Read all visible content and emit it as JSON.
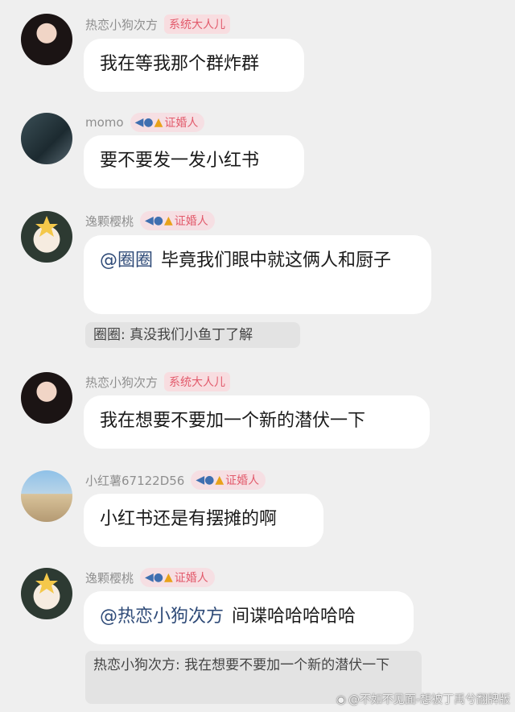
{
  "messages": [
    {
      "username": "热恋小狗次方",
      "badge": "系统大人儿",
      "text": "我在等我那个群炸群"
    },
    {
      "username": "momo",
      "badge": "证婚人",
      "text": "要不要发一发小红书"
    },
    {
      "username": "逸颗樱桃",
      "badge": "证婚人",
      "mention": "@圈圈",
      "text": "毕竟我们眼中就这俩人和厨子",
      "quote": "圈圈: 真没我们小鱼丁了解"
    },
    {
      "username": "热恋小狗次方",
      "badge": "系统大人儿",
      "text": "我在想要不要加一个新的潜伏一下"
    },
    {
      "username": "小红薯67122D56",
      "badge": "证婚人",
      "text": "小红书还是有摆摊的啊"
    },
    {
      "username": "逸颗樱桃",
      "badge": "证婚人",
      "mention": "@热恋小狗次方",
      "text": "间谍哈哈哈哈哈",
      "quote": "热恋小狗次方: 我在想要不要加一个新的潜伏一下"
    }
  ],
  "icons": {
    "fish": "fish-icon",
    "bell": "bell-icon"
  },
  "colors": {
    "badge_text": "#e25a6b",
    "mention": "#2f4b78",
    "background": "#efefef"
  },
  "watermark": "@不如不见面-想被丁禹兮翻牌版"
}
